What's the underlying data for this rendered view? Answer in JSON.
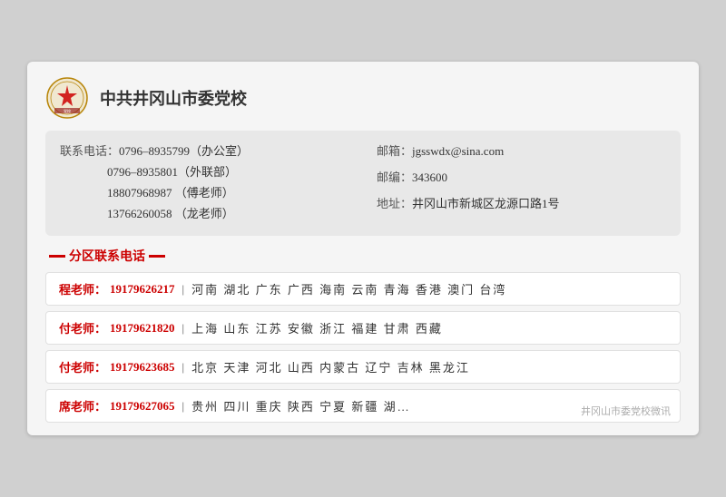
{
  "header": {
    "org_name": "中共井冈山市委党校"
  },
  "info": {
    "phone_label": "联系电话：",
    "phone1": "0796–8935799（办公室）",
    "phone2": "0796–8935801（外联部）",
    "phone3": "18807968987 （傅老师）",
    "phone4": "13766260058 （龙老师）",
    "email_label": "邮箱：",
    "email": "jgsswdx@sina.com",
    "postcode_label": "邮编：",
    "postcode": "343600",
    "address_label": "地址：",
    "address": "井冈山市新城区龙源口路1号"
  },
  "section_title": "分区联系电话",
  "contacts": [
    {
      "teacher": "程老师：",
      "phone": "19179626217",
      "regions": "河南  湖北  广东  广西  海南  云南  青海  香港  澳门  台湾"
    },
    {
      "teacher": "付老师：",
      "phone": "19179621820",
      "regions": "上海  山东  江苏  安徽  浙江  福建  甘肃  西藏"
    },
    {
      "teacher": "付老师：",
      "phone": "19179623685",
      "regions": "北京  天津  河北  山西  内蒙古  辽宁  吉林  黑龙江"
    },
    {
      "teacher": "席老师：",
      "phone": "19179627065",
      "regions": "贵州  四川  重庆  陕西  宁夏  新疆  湖…",
      "watermark": "井冈山市委党校微讯"
    }
  ]
}
